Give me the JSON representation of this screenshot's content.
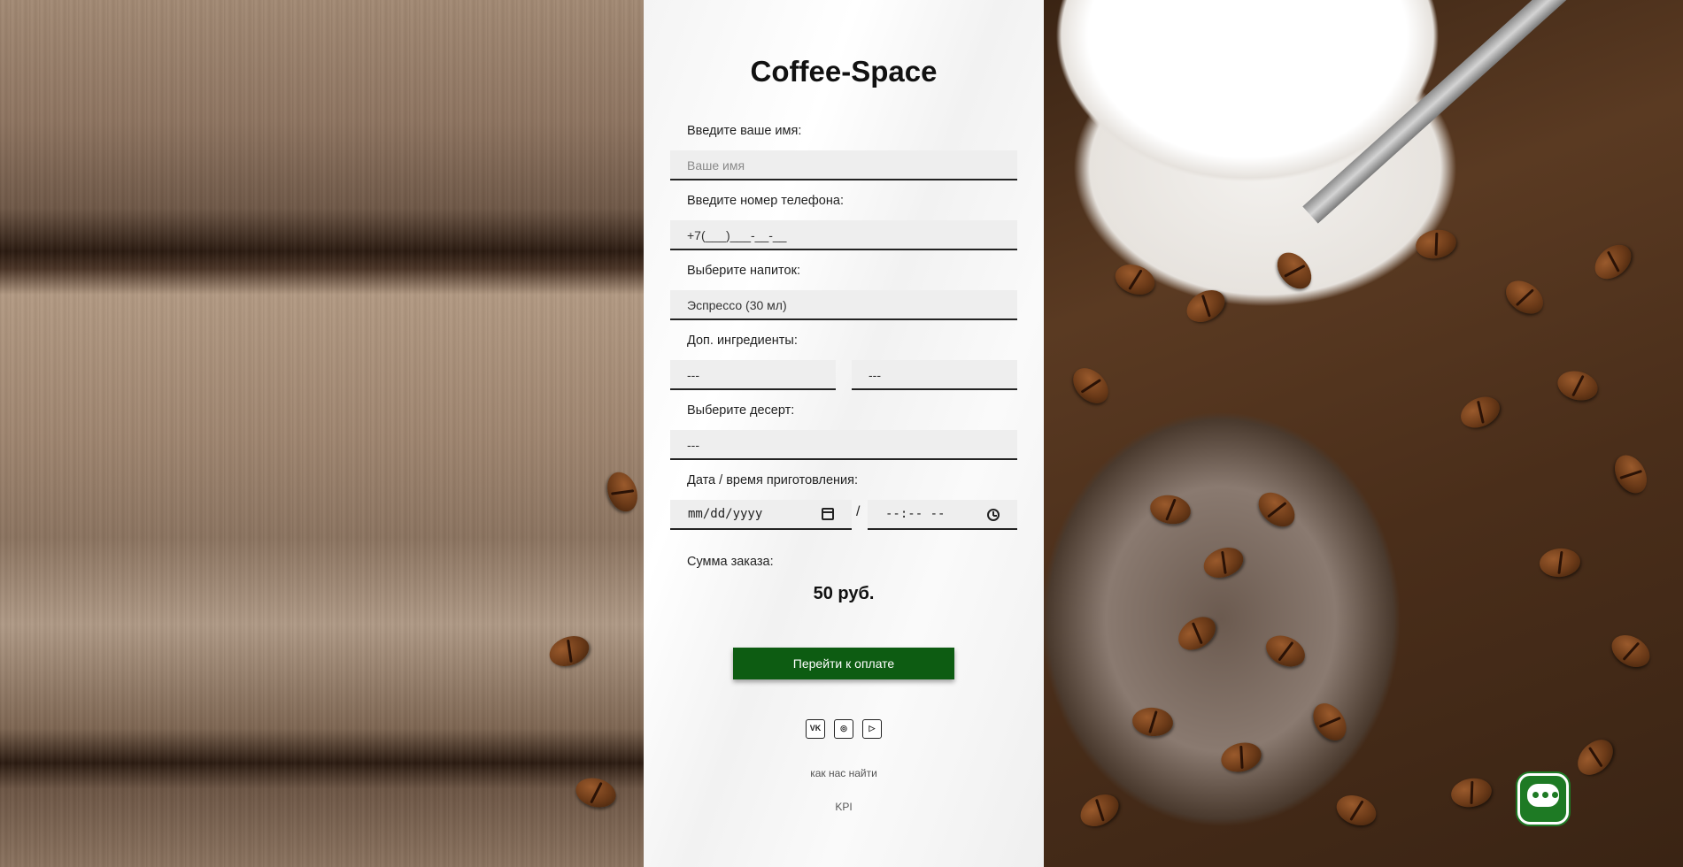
{
  "brand": {
    "title": "Coffee-Space"
  },
  "form": {
    "name": {
      "label": "Введите ваше имя:",
      "placeholder": "Ваше имя"
    },
    "phone": {
      "label": "Введите номер телефона:",
      "value": "+7(___)___-__-__"
    },
    "drink": {
      "label": "Выберите напиток:",
      "value": "Эспрессо (30 мл)"
    },
    "extras": {
      "label": "Доп. ингредиенты:",
      "first": "---",
      "second": "---"
    },
    "dessert": {
      "label": "Выберите десерт:",
      "value": "---"
    },
    "datetime": {
      "label": "Дата / время приготовления:",
      "date_placeholder": "mm/dd/yyyy",
      "separator": "/",
      "time_placeholder": "--:-- --"
    },
    "sum": {
      "label": "Сумма заказа:",
      "value": "50 руб."
    },
    "submit_label": "Перейти к оплате"
  },
  "social": [
    {
      "icon": "vk-icon",
      "glyph": "VK"
    },
    {
      "icon": "instagram-icon",
      "glyph": "◎"
    },
    {
      "icon": "youtube-icon",
      "glyph": "▷"
    }
  ],
  "footer": {
    "find_us": "как нас найти",
    "kpi": "KPI"
  },
  "colors": {
    "primary": "#0d5c12",
    "chat": "#1e7a24"
  }
}
